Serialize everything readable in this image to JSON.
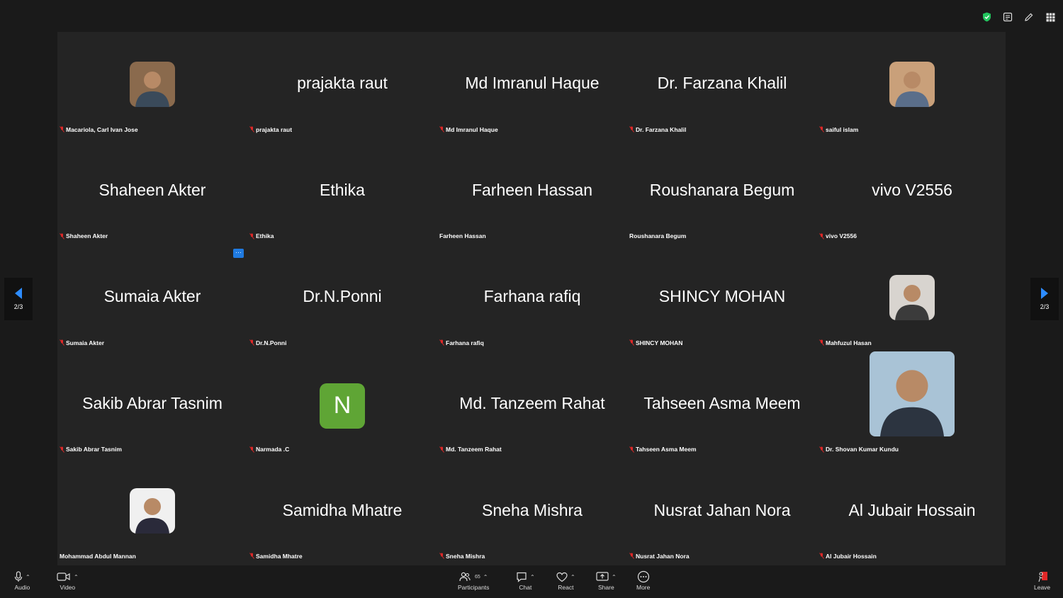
{
  "tiles": [
    {
      "big_name": "",
      "label": "Macariola, Carl Ivan Jose",
      "avatar": "photo",
      "avatar_colors": [
        "#8a6a4d",
        "#3a4a5a"
      ],
      "muted": true
    },
    {
      "big_name": "prajakta raut",
      "label": "prajakta raut",
      "avatar": "none",
      "muted": true
    },
    {
      "big_name": "Md Imranul Haque",
      "label": "Md Imranul Haque",
      "avatar": "none",
      "muted": true
    },
    {
      "big_name": "Dr. Farzana Khalil",
      "label": "Dr. Farzana Khalil",
      "avatar": "none",
      "muted": true
    },
    {
      "big_name": "",
      "label": "saiful islam",
      "avatar": "photo",
      "avatar_colors": [
        "#c9a07a",
        "#5a6e8a"
      ],
      "muted": true
    },
    {
      "big_name": "Shaheen Akter",
      "label": "Shaheen Akter",
      "avatar": "none",
      "muted": true
    },
    {
      "big_name": "Ethika",
      "label": "Ethika",
      "avatar": "none",
      "muted": true
    },
    {
      "big_name": "Farheen Hassan",
      "label": "Farheen Hassan",
      "avatar": "none",
      "muted": false
    },
    {
      "big_name": "Roushanara Begum",
      "label": "Roushanara Begum",
      "avatar": "none",
      "muted": false
    },
    {
      "big_name": "vivo V2556",
      "label": "vivo V2556",
      "avatar": "none",
      "muted": true
    },
    {
      "big_name": "Sumaia Akter",
      "label": "Sumaia Akter",
      "avatar": "none",
      "muted": true
    },
    {
      "big_name": "Dr.N.Ponni",
      "label": "Dr.N.Ponni",
      "avatar": "none",
      "muted": true
    },
    {
      "big_name": "Farhana rafiq",
      "label": "Farhana rafiq",
      "avatar": "none",
      "muted": true
    },
    {
      "big_name": "SHINCY MOHAN",
      "label": "SHINCY MOHAN",
      "avatar": "none",
      "muted": true
    },
    {
      "big_name": "",
      "label": "Mahfuzul Hasan",
      "avatar": "photo",
      "avatar_colors": [
        "#d8d4cf",
        "#3b3b3b"
      ],
      "muted": true
    },
    {
      "big_name": "Sakib Abrar Tasnim",
      "label": "Sakib Abrar Tasnim",
      "avatar": "none",
      "muted": true
    },
    {
      "big_name": "",
      "label": "Narmada .C",
      "avatar": "letter",
      "letter": "N",
      "muted": true
    },
    {
      "big_name": "Md. Tanzeem Rahat",
      "label": "Md. Tanzeem Rahat",
      "avatar": "none",
      "muted": true
    },
    {
      "big_name": "Tahseen Asma Meem",
      "label": "Tahseen Asma Meem",
      "avatar": "none",
      "muted": true
    },
    {
      "big_name": "",
      "label": "Dr. Shovan Kumar Kundu",
      "avatar": "photo-large",
      "avatar_colors": [
        "#a9c3d6",
        "#2c3440"
      ],
      "muted": true
    },
    {
      "big_name": "",
      "label": "Mohammad Abdul Mannan",
      "avatar": "photo",
      "avatar_colors": [
        "#f0f0f0",
        "#2a2a3a"
      ],
      "muted": false
    },
    {
      "big_name": "Samidha Mhatre",
      "label": "Samidha Mhatre",
      "avatar": "none",
      "muted": true
    },
    {
      "big_name": "Sneha Mishra",
      "label": "Sneha Mishra",
      "avatar": "none",
      "muted": true
    },
    {
      "big_name": "Nusrat Jahan Nora",
      "label": "Nusrat Jahan Nora",
      "avatar": "none",
      "muted": true
    },
    {
      "big_name": "Al Jubair Hossain",
      "label": "Al Jubair Hossain",
      "avatar": "none",
      "muted": true
    }
  ],
  "pagination": {
    "left_page": "2/3",
    "right_page": "2/3"
  },
  "more_button": "···",
  "toolbar": {
    "audio": "Audio",
    "video": "Video",
    "participants": "Participants",
    "participants_count": "65",
    "chat": "Chat",
    "react": "React",
    "share": "Share",
    "more": "More",
    "leave": "Leave"
  },
  "colors": {
    "mute": "#e02828",
    "accent": "#1f7ae0",
    "shield": "#22c55e",
    "leave": "#e02828"
  }
}
